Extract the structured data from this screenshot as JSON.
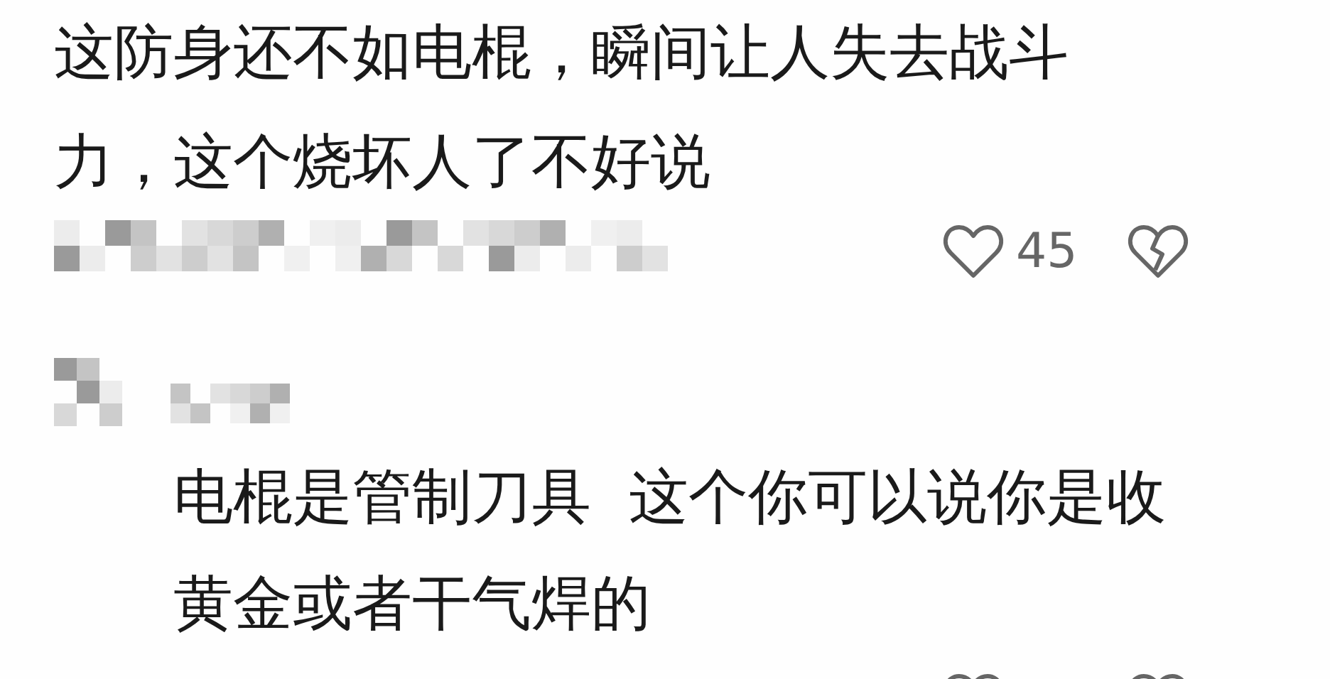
{
  "comments": [
    {
      "text": "这防身还不如电棍，瞬间让人失去战斗力，这个烧坏人了不好说",
      "meta": {
        "kind": "mosaic"
      },
      "likes": "45"
    },
    {
      "avatar": {
        "kind": "mosaic"
      },
      "author": {
        "kind": "mosaic"
      },
      "text": "电棍是管制刀具  这个你可以说你是收黄金或者干气焊的"
    }
  ]
}
